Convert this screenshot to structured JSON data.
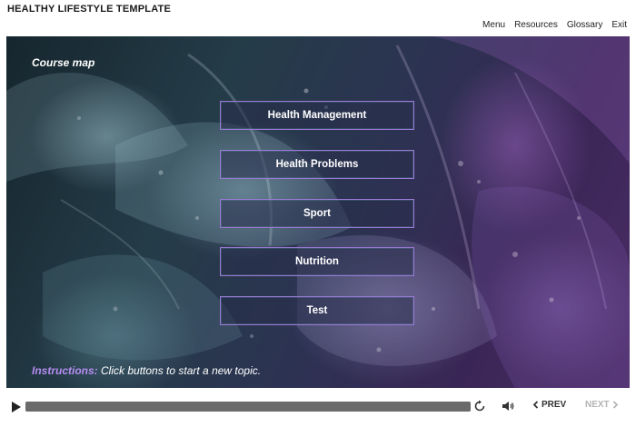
{
  "app": {
    "title": "HEALTHY LIFESTYLE TEMPLATE"
  },
  "top_nav": {
    "items": [
      "Menu",
      "Resources",
      "Glossary",
      "Exit"
    ]
  },
  "slide": {
    "heading": "Course map",
    "topics": [
      "Health Management",
      "Health Problems",
      "Sport",
      "Nutrition",
      "Test"
    ],
    "instructions_label": "Instructions:",
    "instructions_text": "Click buttons to start a new topic."
  },
  "player": {
    "progress_percent": 100,
    "prev_label": "PREV",
    "next_label": "NEXT",
    "next_enabled": false,
    "icons": [
      "play-icon",
      "replay-icon",
      "volume-icon",
      "chevron-left-icon",
      "chevron-right-icon"
    ]
  },
  "colors": {
    "button_border": "#9b79d6",
    "instructions_accent": "#b58cf0",
    "progress_track": "#8c8c8c",
    "disabled_text": "#b5b5b5"
  }
}
